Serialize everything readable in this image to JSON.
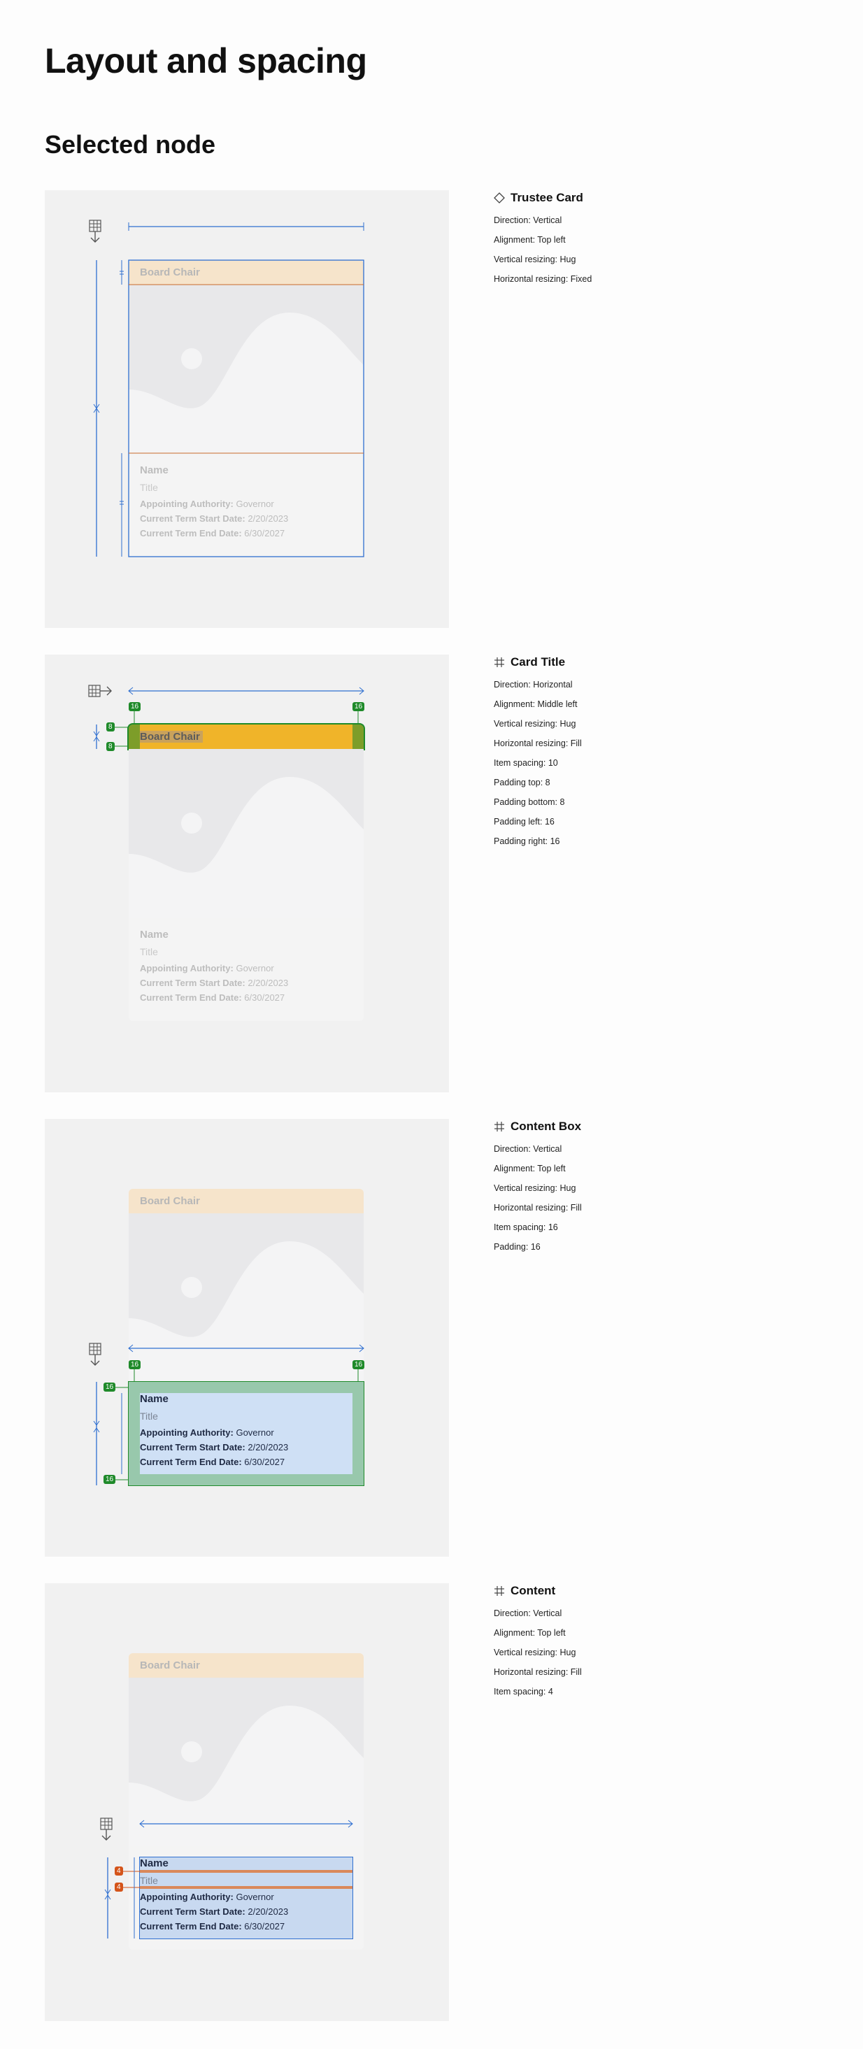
{
  "page": {
    "title": "Layout and spacing",
    "section": "Selected node"
  },
  "card": {
    "title": "Board Chair",
    "name": "Name",
    "subtitle": "Title",
    "rows": [
      {
        "label": "Appointing Authority:",
        "value": "Governor"
      },
      {
        "label": "Current Term Start Date:",
        "value": "2/20/2023"
      },
      {
        "label": "Current Term End Date:",
        "value": "6/30/2027"
      }
    ]
  },
  "nodes": [
    {
      "icon": "component-icon",
      "name": "Trustee Card",
      "props": [
        "Direction: Vertical",
        "Alignment: Top left",
        "Vertical resizing: Hug",
        "Horizontal resizing: Fixed"
      ]
    },
    {
      "icon": "frame-icon",
      "name": "Card Title",
      "props": [
        "Direction: Horizontal",
        "Alignment: Middle left",
        "Vertical resizing: Hug",
        "Horizontal resizing: Fill",
        "Item spacing: 10",
        "Padding top: 8",
        "Padding bottom: 8",
        "Padding left: 16",
        "Padding right: 16"
      ],
      "padding_tags": {
        "left": "16",
        "right": "16",
        "top": "8",
        "bottom": "8"
      }
    },
    {
      "icon": "frame-icon",
      "name": "Content Box",
      "props": [
        "Direction: Vertical",
        "Alignment: Top left",
        "Vertical resizing: Hug",
        "Horizontal resizing: Fill",
        "Item spacing: 16",
        "Padding: 16"
      ],
      "padding_tags": {
        "left": "16",
        "right": "16",
        "top": "16",
        "bottom": "16"
      }
    },
    {
      "icon": "frame-icon",
      "name": "Content",
      "props": [
        "Direction: Vertical",
        "Alignment: Top left",
        "Vertical resizing: Hug",
        "Horizontal resizing: Fill",
        "Item spacing: 4"
      ],
      "spacing_tags": [
        "4",
        "4"
      ]
    }
  ],
  "colors": {
    "measure_blue": "#2f6fd0",
    "padding_green": "#1f8a2a",
    "spacing_orange": "#d4541a",
    "title_bg": "#f6e4cb",
    "highlight_yellow": "#f0b429",
    "content_blue": "#cfe0f5"
  }
}
